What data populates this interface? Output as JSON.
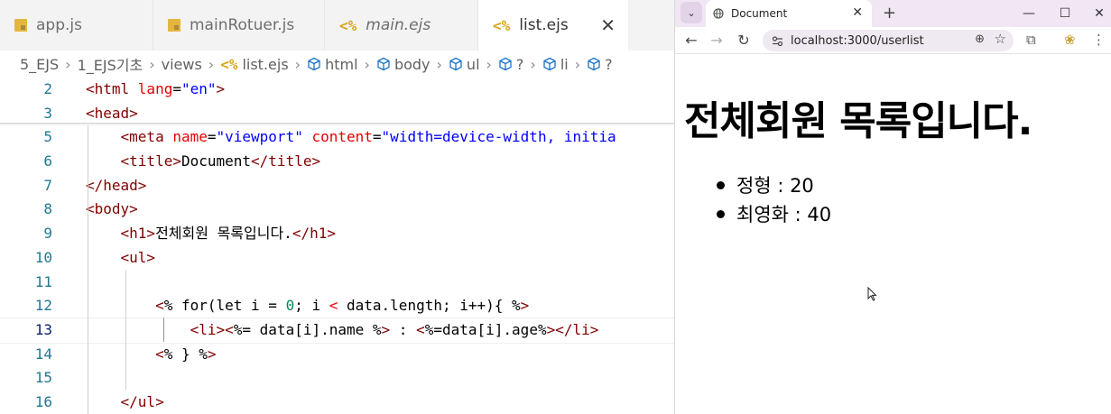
{
  "editor": {
    "tabs": [
      {
        "label": "app.js",
        "icon": "js-file-icon",
        "italic": false,
        "active": false
      },
      {
        "label": "mainRotuer.js",
        "icon": "js-file-icon",
        "italic": false,
        "active": false
      },
      {
        "label": "main.ejs",
        "icon": "ejs-file-icon",
        "italic": true,
        "active": false
      },
      {
        "label": "list.ejs",
        "icon": "ejs-file-icon",
        "italic": false,
        "active": true
      }
    ],
    "close_glyph": "✕",
    "breadcrumb": [
      "5_EJS",
      "1_EJS기초",
      "views",
      "list.ejs",
      "html",
      "body",
      "ul",
      "?",
      "li",
      "?"
    ],
    "lines": [
      {
        "num": "2",
        "tokens": [
          [
            "t-tag",
            "<html "
          ],
          [
            "t-attr",
            "lang"
          ],
          [
            "t-txt",
            "="
          ],
          [
            "t-str",
            "\"en\""
          ],
          [
            "t-tag",
            ">"
          ]
        ]
      },
      {
        "num": "3",
        "tokens": [
          [
            "t-tag",
            "<head>"
          ]
        ]
      },
      {
        "num": "5",
        "tokens": [
          [
            "t-txt",
            "    "
          ],
          [
            "t-tag",
            "<meta "
          ],
          [
            "t-attr",
            "name"
          ],
          [
            "t-txt",
            "="
          ],
          [
            "t-str",
            "\"viewport\""
          ],
          [
            "t-txt",
            " "
          ],
          [
            "t-attr",
            "content"
          ],
          [
            "t-txt",
            "="
          ],
          [
            "t-str",
            "\"width=device-width, initia"
          ]
        ]
      },
      {
        "num": "6",
        "tokens": [
          [
            "t-txt",
            "    "
          ],
          [
            "t-tag",
            "<title>"
          ],
          [
            "t-txt",
            "Document"
          ],
          [
            "t-tag",
            "</title>"
          ]
        ]
      },
      {
        "num": "7",
        "tokens": [
          [
            "t-tag",
            "</head>"
          ]
        ]
      },
      {
        "num": "8",
        "tokens": [
          [
            "t-tag",
            "<body>"
          ]
        ]
      },
      {
        "num": "9",
        "tokens": [
          [
            "t-txt",
            "    "
          ],
          [
            "t-tag",
            "<h1>"
          ],
          [
            "t-txt",
            "전체회원 목록입니다."
          ],
          [
            "t-tag",
            "</h1>"
          ]
        ]
      },
      {
        "num": "10",
        "tokens": [
          [
            "t-txt",
            "    "
          ],
          [
            "t-tag",
            "<ul>"
          ]
        ]
      },
      {
        "num": "11",
        "tokens": []
      },
      {
        "num": "12",
        "tokens": [
          [
            "t-txt",
            "        "
          ],
          [
            "t-ejs",
            "<"
          ],
          [
            "t-txt",
            "% for(let i = "
          ],
          [
            "t-num",
            "0"
          ],
          [
            "t-txt",
            "; i "
          ],
          [
            "t-attr",
            "<"
          ],
          [
            "t-txt",
            " data.length; i++){ %"
          ],
          [
            "t-ejs",
            ">"
          ]
        ]
      },
      {
        "num": "13",
        "tokens": [
          [
            "t-txt",
            "            "
          ],
          [
            "t-tag",
            "<li>"
          ],
          [
            "t-ejs",
            "<"
          ],
          [
            "t-txt",
            "%= data[i].name %"
          ],
          [
            "t-ejs",
            ">"
          ],
          [
            "t-txt",
            " : "
          ],
          [
            "t-ejs",
            "<"
          ],
          [
            "t-txt",
            "%=data[i].age%"
          ],
          [
            "t-ejs",
            ">"
          ],
          [
            "t-tag",
            "</li>"
          ]
        ]
      },
      {
        "num": "14",
        "tokens": [
          [
            "t-txt",
            "        "
          ],
          [
            "t-ejs",
            "<"
          ],
          [
            "t-txt",
            "% } %"
          ],
          [
            "t-ejs",
            ">"
          ]
        ]
      },
      {
        "num": "15",
        "tokens": []
      },
      {
        "num": "16",
        "tokens": [
          [
            "t-txt",
            "    "
          ],
          [
            "t-tag",
            "</ul>"
          ]
        ]
      }
    ],
    "current_line": "13"
  },
  "browser": {
    "tab_title": "Document",
    "tab_close": "✕",
    "new_tab": "+",
    "url": "localhost:3000/userlist",
    "window_controls": [
      "—",
      "☐",
      "✕"
    ],
    "page": {
      "heading": "전체회원 목록입니다.",
      "items": [
        "정형 : 20",
        "최영화 : 40"
      ]
    }
  },
  "colors": {
    "tag": "#800000",
    "attr": "#e50000",
    "string": "#0000ff",
    "line_number": "#237893",
    "ejs_icon": "#d9a51a",
    "js_icon": "#e5b63e",
    "browser_tabstrip": "#f1e6f4"
  }
}
